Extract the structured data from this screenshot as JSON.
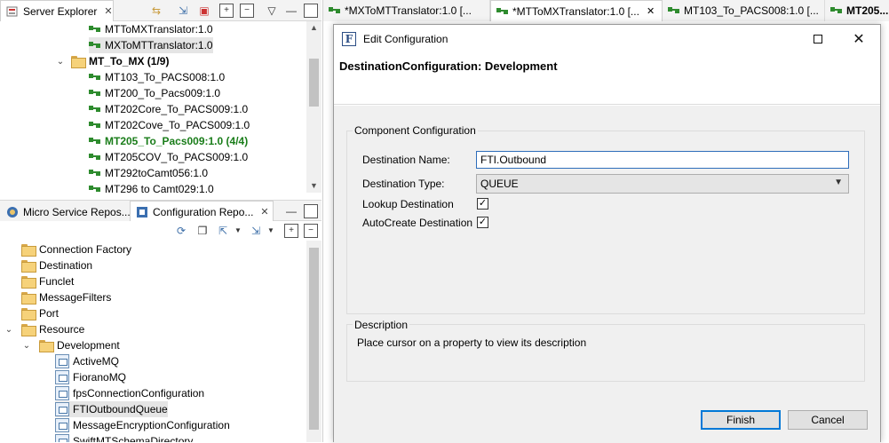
{
  "server_explorer": {
    "tab_label": "Server Explorer",
    "items": [
      {
        "label": "MTToMXTranslator:1.0",
        "type": "service",
        "indent": 1
      },
      {
        "label": "MXToMTTranslator:1.0",
        "type": "service",
        "indent": 1,
        "selected": true
      },
      {
        "label": "MT_To_MX (1/9)",
        "type": "group",
        "indent": 0
      },
      {
        "label": "MT103_To_PACS008:1.0",
        "type": "service",
        "indent": 1
      },
      {
        "label": "MT200_To_Pacs009:1.0",
        "type": "service",
        "indent": 1
      },
      {
        "label": "MT202Core_To_PACS009:1.0",
        "type": "service",
        "indent": 1
      },
      {
        "label": "MT202Cove_To_PACS009:1.0",
        "type": "service",
        "indent": 1
      },
      {
        "label": "MT205_To_Pacs009:1.0 (4/4)",
        "type": "service-running",
        "indent": 1
      },
      {
        "label": "MT205COV_To_PACS009:1.0",
        "type": "service",
        "indent": 1
      },
      {
        "label": "MT292toCamt056:1.0",
        "type": "service",
        "indent": 1
      },
      {
        "label": "MT296 to Camt029:1.0",
        "type": "service",
        "indent": 1
      }
    ]
  },
  "lower_views": {
    "tab1_label": "Micro Service Repos...",
    "tab2_label": "Configuration Repo..."
  },
  "config_tree": {
    "items": [
      {
        "label": "Connection Factory",
        "kind": "folder",
        "level": 0
      },
      {
        "label": "Destination",
        "kind": "folder",
        "level": 0
      },
      {
        "label": "Funclet",
        "kind": "folder",
        "level": 0
      },
      {
        "label": "MessageFilters",
        "kind": "folder",
        "level": 0
      },
      {
        "label": "Port",
        "kind": "folder",
        "level": 0
      },
      {
        "label": "Resource",
        "kind": "folder-open",
        "level": 0
      },
      {
        "label": "Development",
        "kind": "folder-open",
        "level": 1
      },
      {
        "label": "ActiveMQ",
        "kind": "resource",
        "level": 2
      },
      {
        "label": "FioranoMQ",
        "kind": "resource",
        "level": 2
      },
      {
        "label": "fpsConnectionConfiguration",
        "kind": "resource",
        "level": 2
      },
      {
        "label": "FTIOutboundQueue",
        "kind": "resource",
        "level": 2,
        "selected": true
      },
      {
        "label": "MessageEncryptionConfiguration",
        "kind": "resource",
        "level": 2
      },
      {
        "label": "SwiftMTSchemaDirectory",
        "kind": "resource",
        "level": 2
      }
    ]
  },
  "editor_tabs": [
    {
      "label": "*MXToMTTranslator:1.0 [..."
    },
    {
      "label": "*MTToMXTranslator:1.0 [...",
      "active": true
    },
    {
      "label": "MT103_To_PACS008:1.0 [..."
    },
    {
      "label": "MT205..."
    }
  ],
  "dialog": {
    "title": "Edit Configuration",
    "app_icon_letter": "F",
    "heading": "DestinationConfiguration: Development",
    "component_group_label": "Component Configuration",
    "fields": {
      "destination_name_label": "Destination Name:",
      "destination_name_value": "FTI.Outbound",
      "destination_type_label": "Destination Type:",
      "destination_type_value": "QUEUE",
      "lookup_label": "Lookup Destination",
      "lookup_checked": true,
      "autocreate_label": "AutoCreate Destination",
      "autocreate_checked": true
    },
    "description_label": "Description",
    "description_text": "Place cursor on a property to view its description",
    "finish_label": "Finish",
    "cancel_label": "Cancel"
  }
}
